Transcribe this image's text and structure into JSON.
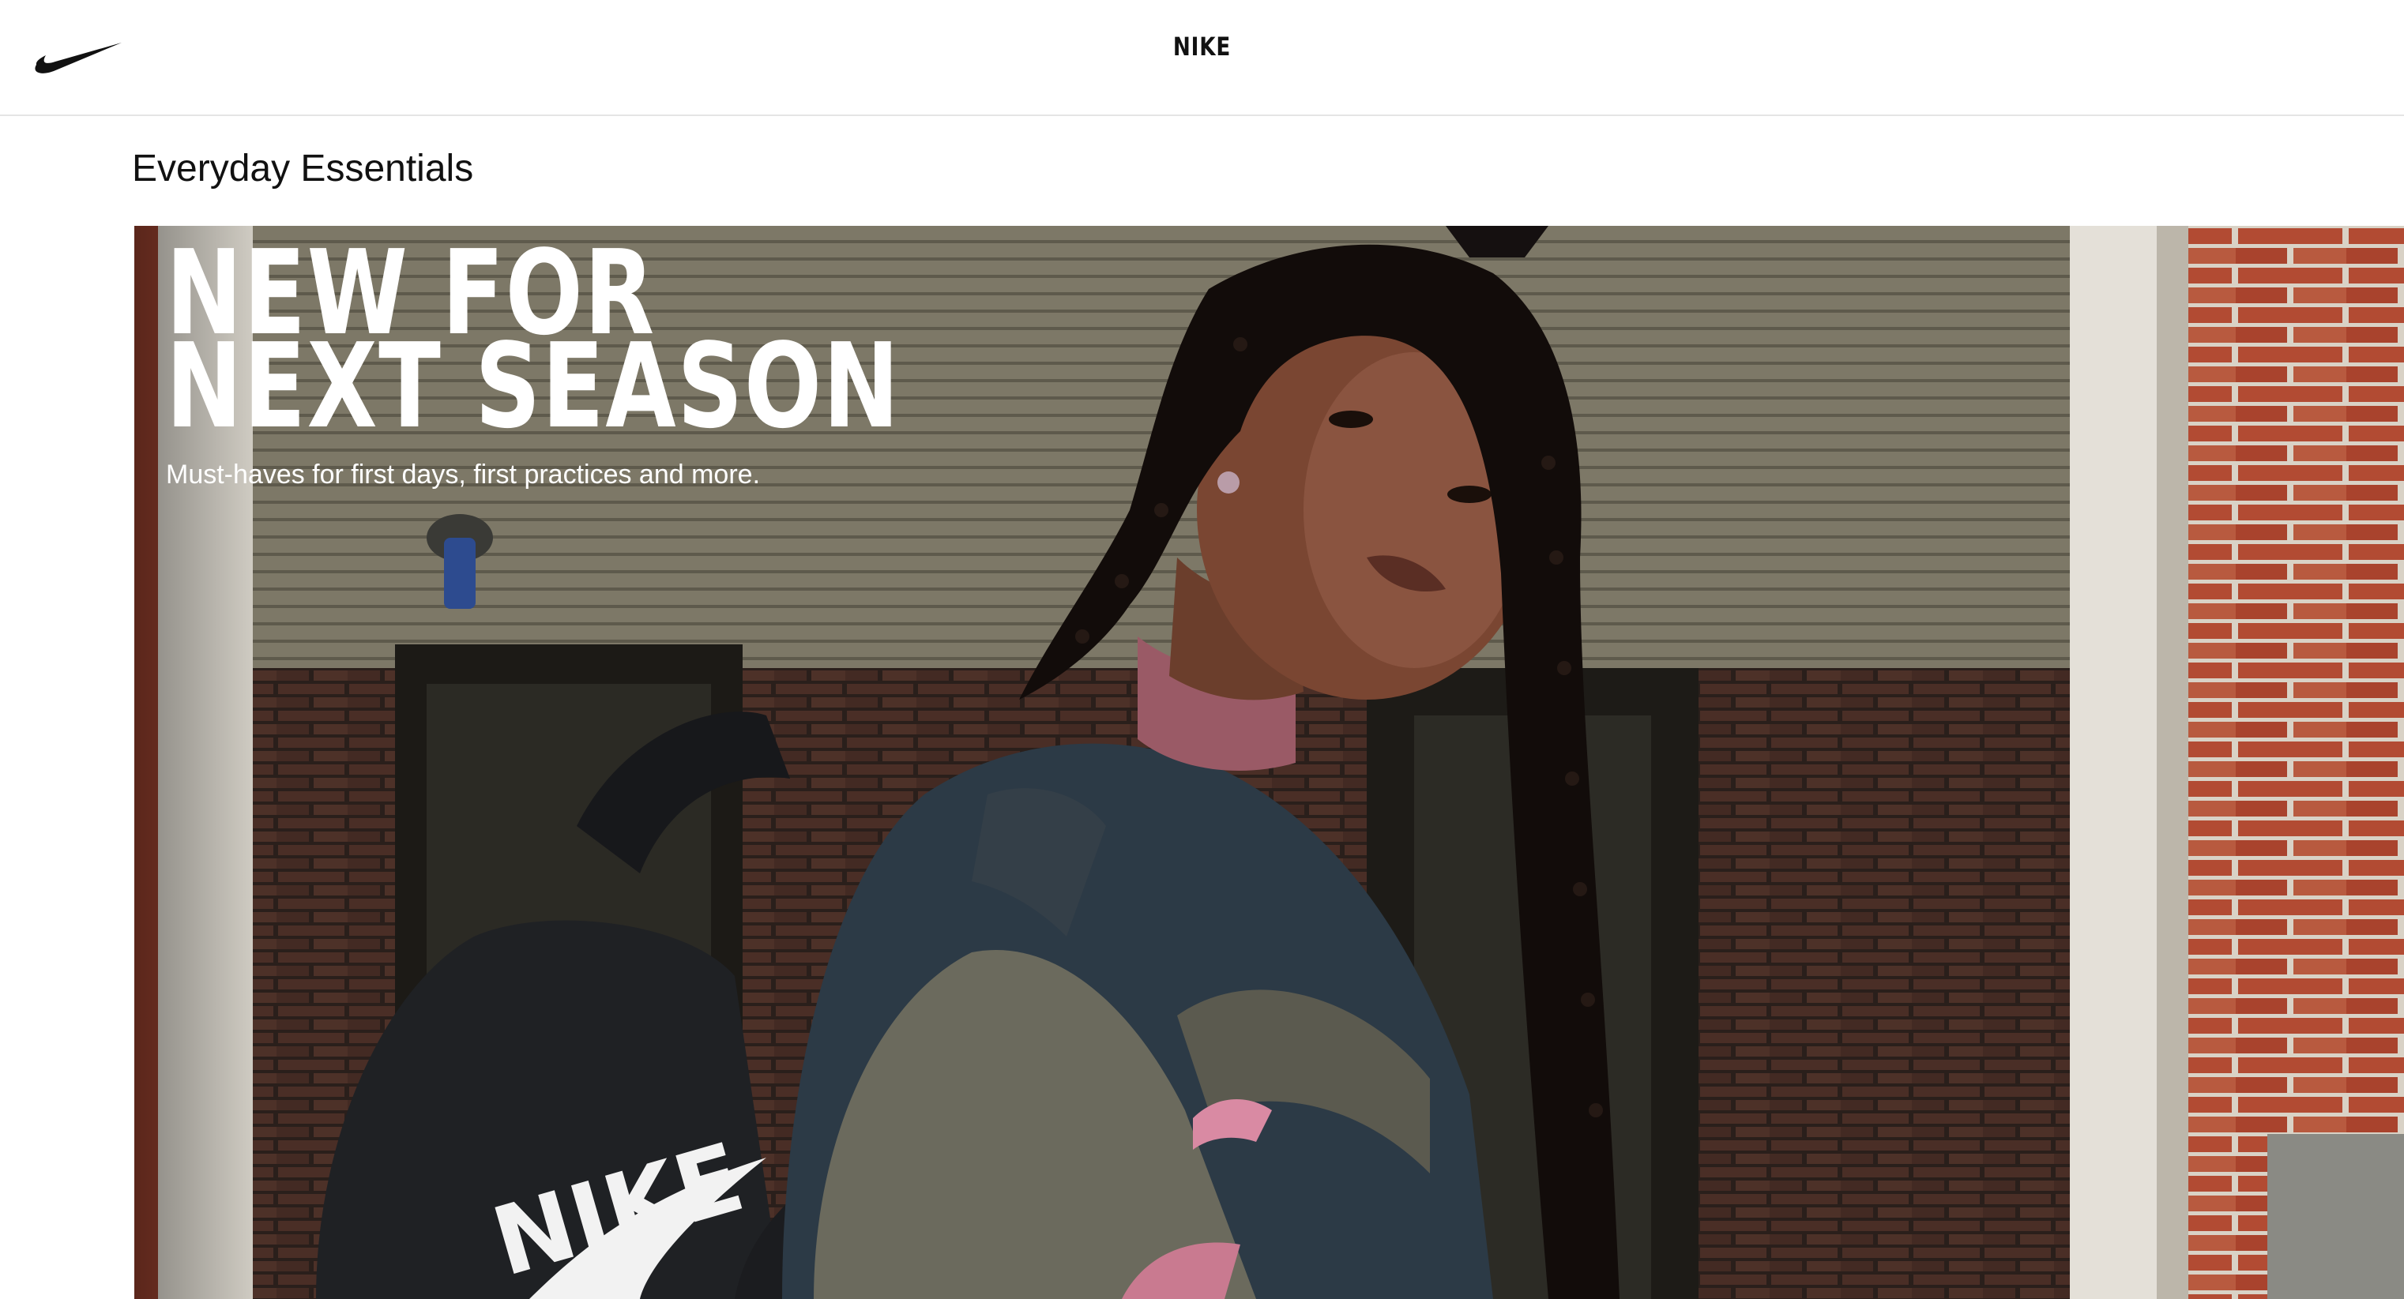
{
  "header": {
    "logo_icon": "swoosh-logo-icon",
    "title": "NIKE"
  },
  "section": {
    "title": "Everyday Essentials"
  },
  "hero": {
    "headline_line1": "NEW FOR",
    "headline_line2": "NEXT SEASON",
    "subtitle": "Must-haves for first days, first practices and more.",
    "backpack_brand_text": "NIKE"
  },
  "colors": {
    "header_bg": "#ffffff",
    "text_primary": "#111111",
    "hero_text": "#ffffff",
    "brick": "#a8452f",
    "jacket_navy": "#2c3a46",
    "jacket_olive": "#6b6a5d",
    "accent_pink": "#d98aa3"
  }
}
